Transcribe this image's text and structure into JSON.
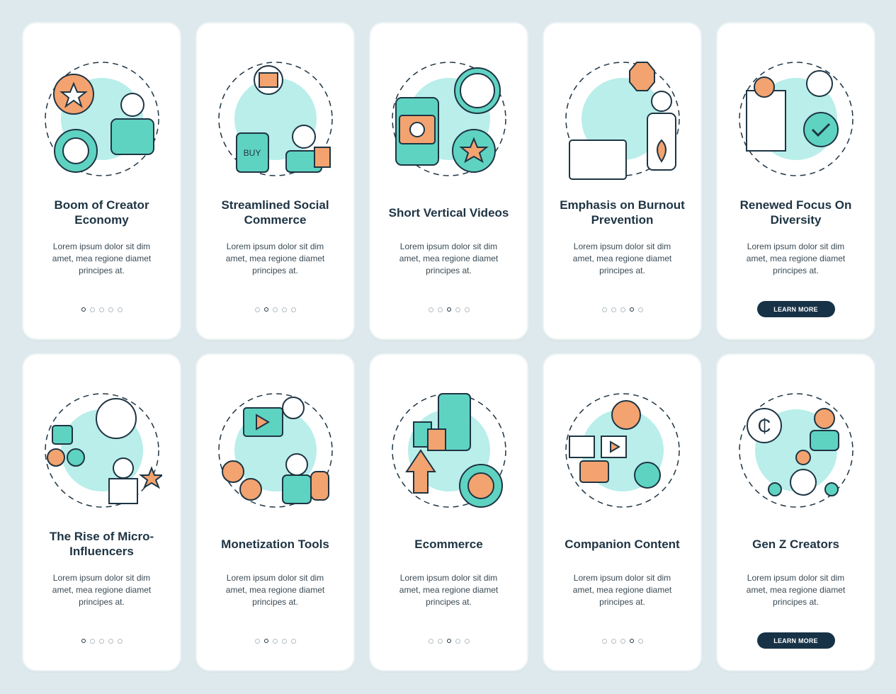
{
  "colors": {
    "teal": "#5fd3c1",
    "light_teal": "#b9eeea",
    "orange": "#f3a36f",
    "dark": "#1e3443",
    "button": "#173246"
  },
  "cards": [
    {
      "title": "Boom of Creator Economy",
      "description": "Lorem ipsum dolor sit dim amet, mea regione diamet principes at.",
      "icon": "creator-economy-icon",
      "active_dot": 0,
      "button": null
    },
    {
      "title": "Streamlined Social Commerce",
      "description": "Lorem ipsum dolor sit dim amet, mea regione diamet principes at.",
      "icon": "social-commerce-icon",
      "active_dot": 1,
      "button": null
    },
    {
      "title": "Short Vertical Videos",
      "description": "Lorem ipsum dolor sit dim amet, mea regione diamet principes at.",
      "icon": "vertical-videos-icon",
      "active_dot": 2,
      "button": null
    },
    {
      "title": "Emphasis on Burnout Prevention",
      "description": "Lorem ipsum dolor sit dim amet, mea regione diamet principes at.",
      "icon": "burnout-prevention-icon",
      "active_dot": 3,
      "button": null
    },
    {
      "title": "Renewed Focus On Diversity",
      "description": "Lorem ipsum dolor sit dim amet, mea regione diamet principes at.",
      "icon": "diversity-icon",
      "active_dot": 4,
      "button": "LEARN MORE"
    },
    {
      "title": "The Rise of Micro-Influencers",
      "description": "Lorem ipsum dolor sit dim amet, mea regione diamet principes at.",
      "icon": "micro-influencers-icon",
      "active_dot": 0,
      "button": null
    },
    {
      "title": "Monetization Tools",
      "description": "Lorem ipsum dolor sit dim amet, mea regione diamet principes at.",
      "icon": "monetization-tools-icon",
      "active_dot": 1,
      "button": null
    },
    {
      "title": "Ecommerce",
      "description": "Lorem ipsum dolor sit dim amet, mea regione diamet principes at.",
      "icon": "ecommerce-icon",
      "active_dot": 2,
      "button": null
    },
    {
      "title": "Companion Content",
      "description": "Lorem ipsum dolor sit dim amet, mea regione diamet principes at.",
      "icon": "companion-content-icon",
      "active_dot": 3,
      "button": null
    },
    {
      "title": "Gen Z Creators",
      "description": "Lorem ipsum dolor sit dim amet, mea regione diamet principes at.",
      "icon": "gen-z-creators-icon",
      "active_dot": 4,
      "button": "LEARN MORE"
    }
  ]
}
